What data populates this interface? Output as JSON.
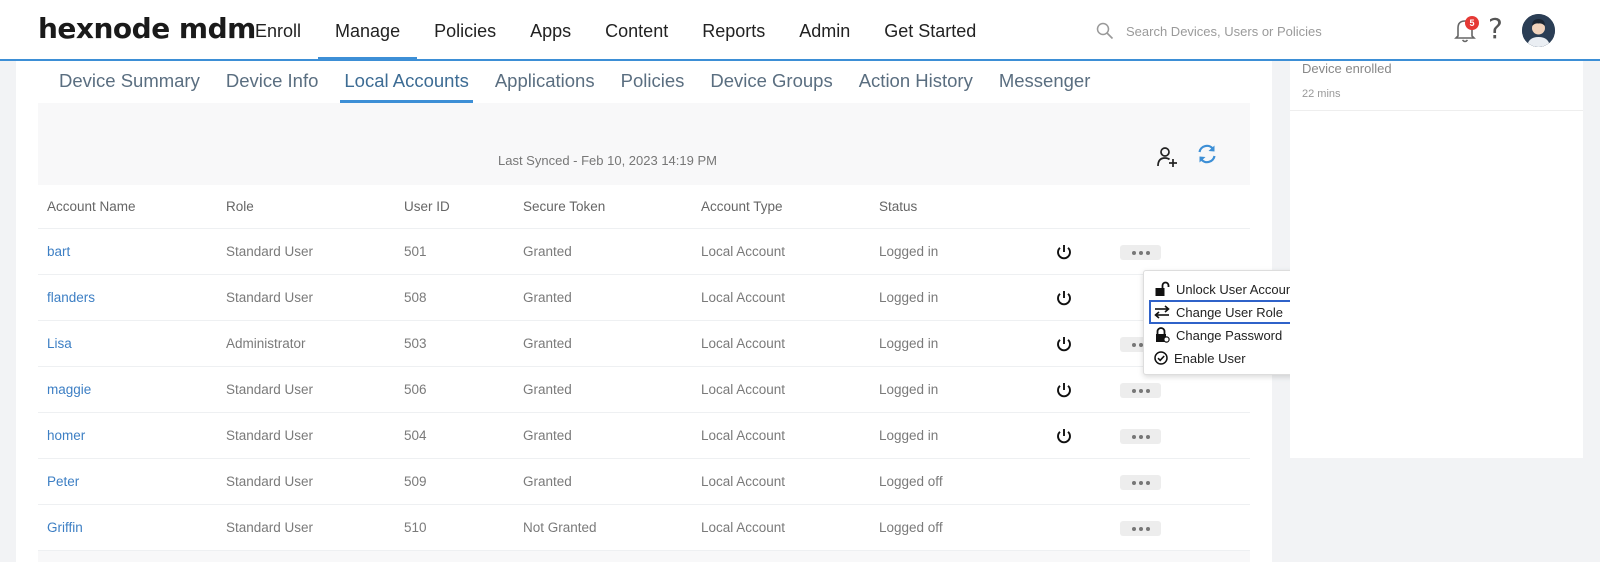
{
  "app": {
    "logo": "hexnode mdm"
  },
  "nav": {
    "items": [
      {
        "label": "Enroll"
      },
      {
        "label": "Manage",
        "active": true
      },
      {
        "label": "Policies"
      },
      {
        "label": "Apps"
      },
      {
        "label": "Content"
      },
      {
        "label": "Reports"
      },
      {
        "label": "Admin"
      },
      {
        "label": "Get Started"
      }
    ]
  },
  "search": {
    "placeholder": "Search Devices, Users or Policies"
  },
  "notifications": {
    "count": "5"
  },
  "help": {
    "label": "?"
  },
  "tabs": [
    {
      "label": "Device Summary"
    },
    {
      "label": "Device Info"
    },
    {
      "label": "Local Accounts",
      "active": true
    },
    {
      "label": "Applications"
    },
    {
      "label": "Policies"
    },
    {
      "label": "Device Groups"
    },
    {
      "label": "Action History"
    },
    {
      "label": "Messenger"
    }
  ],
  "sync": {
    "text": "Last Synced - Feb 10, 2023 14:19 PM"
  },
  "table": {
    "columns": [
      "Account Name",
      "Role",
      "User ID",
      "Secure Token",
      "Account Type",
      "Status"
    ],
    "rows": [
      {
        "name": "bart",
        "role": "Standard User",
        "uid": "501",
        "token": "Granted",
        "type": "Local Account",
        "status": "Logged in",
        "power": true
      },
      {
        "name": "flanders",
        "role": "Standard User",
        "uid": "508",
        "token": "Granted",
        "type": "Local Account",
        "status": "Logged in",
        "power": true
      },
      {
        "name": "Lisa",
        "role": "Administrator",
        "uid": "503",
        "token": "Granted",
        "type": "Local Account",
        "status": "Logged in",
        "power": true
      },
      {
        "name": "maggie",
        "role": "Standard User",
        "uid": "506",
        "token": "Granted",
        "type": "Local Account",
        "status": "Logged in",
        "power": true
      },
      {
        "name": "homer",
        "role": "Standard User",
        "uid": "504",
        "token": "Granted",
        "type": "Local Account",
        "status": "Logged in",
        "power": true
      },
      {
        "name": "Peter",
        "role": "Standard User",
        "uid": "509",
        "token": "Granted",
        "type": "Local Account",
        "status": "Logged off",
        "power": false
      },
      {
        "name": "Griffin",
        "role": "Standard User",
        "uid": "510",
        "token": "Not Granted",
        "type": "Local Account",
        "status": "Logged off",
        "power": false
      }
    ]
  },
  "menu": {
    "items": [
      {
        "label": "Unlock User Account",
        "icon": "unlock-icon"
      },
      {
        "label": "Change User Role",
        "icon": "swap-arrows-icon",
        "highlighted": true
      },
      {
        "label": "Change Password",
        "icon": "lock-key-icon"
      },
      {
        "label": "Enable User",
        "icon": "check-circle-icon"
      }
    ]
  },
  "activity": {
    "title": "Device enrolled",
    "time": "22 mins"
  },
  "colors": {
    "accent": "#3d8fd6",
    "link": "#3d7fc4",
    "highlight": "#2f62c9",
    "badge": "#e53935"
  }
}
